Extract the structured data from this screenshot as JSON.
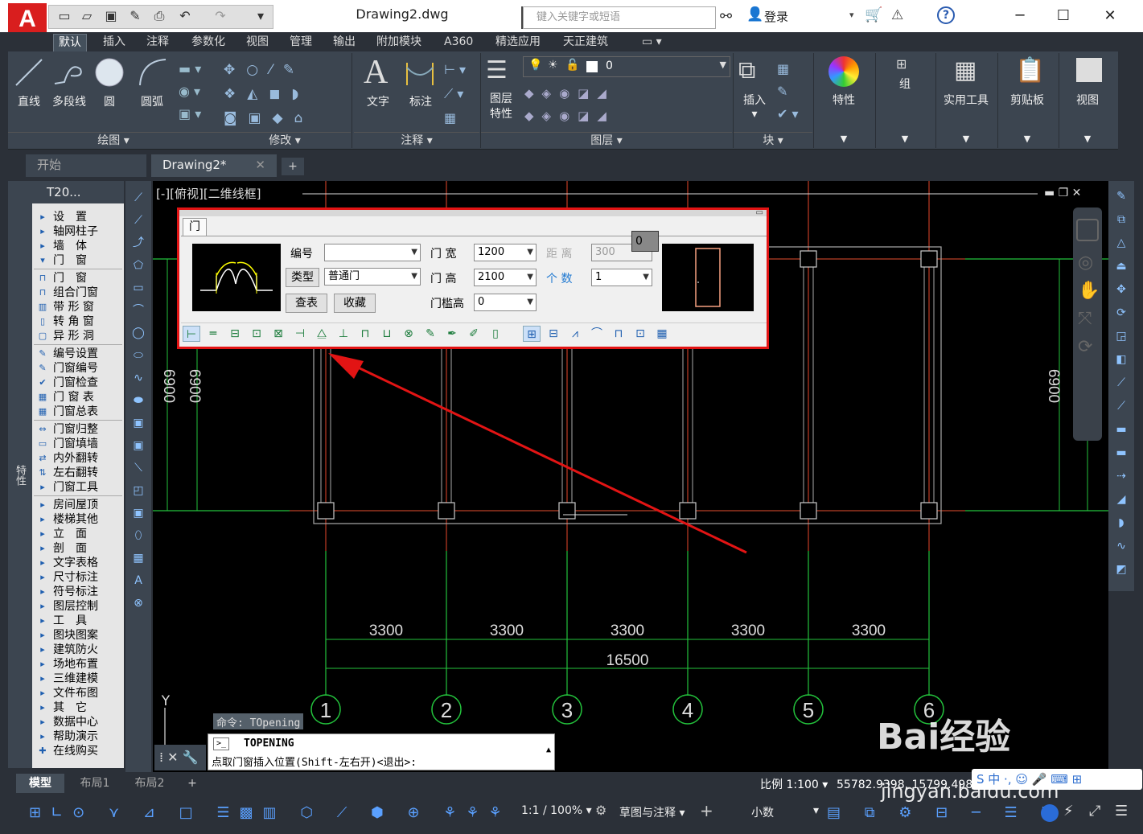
{
  "app": {
    "doc_title": "Drawing2.dwg",
    "search_placeholder": "键入关键字或短语",
    "login": "登录"
  },
  "ribbon_tabs": [
    "默认",
    "插入",
    "注释",
    "参数化",
    "视图",
    "管理",
    "输出",
    "附加模块",
    "A360",
    "精选应用",
    "天正建筑"
  ],
  "ribbon": {
    "draw": {
      "line": "直线",
      "polyline": "多段线",
      "circle": "圆",
      "arc": "圆弧",
      "group": "绘图"
    },
    "modify": {
      "group": "修改"
    },
    "annot": {
      "text": "文字",
      "dim": "标注",
      "group": "注释"
    },
    "layers": {
      "props": "图层\n特性",
      "layer_value": "0",
      "group": "图层"
    },
    "block": {
      "insert": "插入",
      "group": "块"
    },
    "properties": "特性",
    "group_btn": "组",
    "utilities": "实用工具",
    "clipboard": "剪贴板",
    "view": "视图"
  },
  "file_tabs": {
    "start": "开始",
    "drawing": "Drawing2*"
  },
  "viewport_label": "[-][俯视][二维线框]",
  "menu": {
    "title": "T20...",
    "items": [
      "设　置",
      "轴网柱子",
      "墙　体",
      "门　窗",
      "门　窗",
      "组合门窗",
      "带 形 窗",
      "转 角 窗",
      "异 形 洞",
      "编号设置",
      "门窗编号",
      "门窗检查",
      "门 窗 表",
      "门窗总表",
      "门窗归整",
      "门窗填墙",
      "内外翻转",
      "左右翻转",
      "门窗工具",
      "房间屋顶",
      "楼梯其他",
      "立　面",
      "剖　面",
      "文字表格",
      "尺寸标注",
      "符号标注",
      "图层控制",
      "工　具",
      "图块图案",
      "建筑防火",
      "场地布置",
      "三维建模",
      "文件布图",
      "其　它",
      "数据中心",
      "帮助演示",
      "在线购买"
    ]
  },
  "left_palette_label": "特性",
  "dialog": {
    "title": "门",
    "number_label": "编号",
    "number_value": "",
    "type_btn": "类型",
    "type_value": "普通门",
    "lookup_btn": "查表",
    "fav_btn": "收藏",
    "width_label": "门 宽",
    "width_value": "1200",
    "height_label": "门 高",
    "height_value": "2100",
    "sill_label": "门槛高",
    "sill_value": "0",
    "dist_label": "距 离",
    "dist_value": "300",
    "count_label": "个 数",
    "count_value": "1",
    "badge": "0"
  },
  "drawing": {
    "dims": [
      "3300",
      "3300",
      "3300",
      "3300",
      "3300"
    ],
    "total": "16500",
    "vdims": [
      "6900",
      "6900",
      "6900",
      "6900"
    ],
    "axes": [
      "1",
      "2",
      "3",
      "4",
      "5",
      "6"
    ],
    "y_label": "Y"
  },
  "command": {
    "history": "命令: TOpening",
    "cmd": "TOPENING",
    "prompt": "点取门窗插入位置(Shift-左右开)<退出>:"
  },
  "layout_tabs": [
    "模型",
    "布局1",
    "布局2"
  ],
  "status": {
    "scale": "比例 1:100",
    "coords": "55782.9398, 15799.4981, 0",
    "zoom": "1:1 / 100%",
    "workspace": "草图与注释",
    "units": "小数"
  },
  "watermark": {
    "brand": "Bai经验",
    "url": "jingyan.baidu.com"
  },
  "colors": {
    "accent": "#e21414",
    "grid": "#23c23c",
    "cad_bg": "#000000"
  }
}
